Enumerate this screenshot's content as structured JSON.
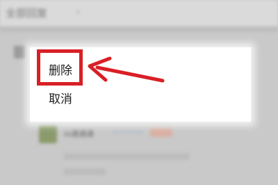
{
  "background": {
    "header_title": "全部回复",
    "header_arrow": "›",
    "comment_username": "lo通通通"
  },
  "dialog": {
    "items": [
      {
        "label": "删除",
        "highlighted": true
      },
      {
        "label": "取消",
        "highlighted": false
      }
    ]
  },
  "annotation": {
    "highlight_color": "#d91f26",
    "arrow_color": "#d91f26"
  }
}
